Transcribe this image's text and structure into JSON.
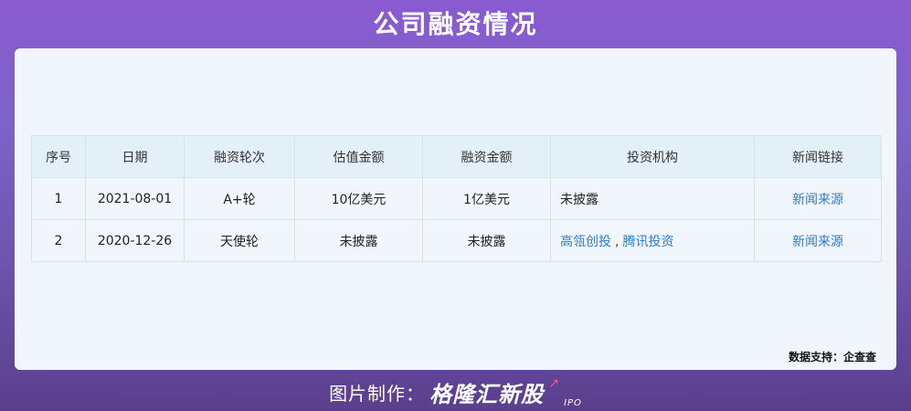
{
  "title": "公司融资情况",
  "watermark": {
    "text": "格隆汇新股",
    "sub": "IPO"
  },
  "table": {
    "headers": [
      "序号",
      "日期",
      "融资轮次",
      "估值金额",
      "融资金额",
      "投资机构",
      "新闻链接"
    ],
    "rows": [
      {
        "index": "1",
        "date": "2021-08-01",
        "round": "A+轮",
        "valuation": "10亿美元",
        "amount": "1亿美元",
        "investors": [
          "未披露"
        ],
        "news": "新闻来源"
      },
      {
        "index": "2",
        "date": "2020-12-26",
        "round": "天使轮",
        "valuation": "未披露",
        "amount": "未披露",
        "investors": [
          "高瓴创投",
          "腾讯投资"
        ],
        "investor_separator": ",",
        "news": "新闻来源"
      }
    ]
  },
  "source": "数据支持：企查查",
  "footer": {
    "label": "图片制作：",
    "logo": "格隆汇新股",
    "logo_sub": "IPO"
  },
  "colors": {
    "link": "#2a7ed0",
    "header_bg": "#e4f0f8",
    "card_bg": "#f1f6fd",
    "background": "#7c63c8"
  }
}
